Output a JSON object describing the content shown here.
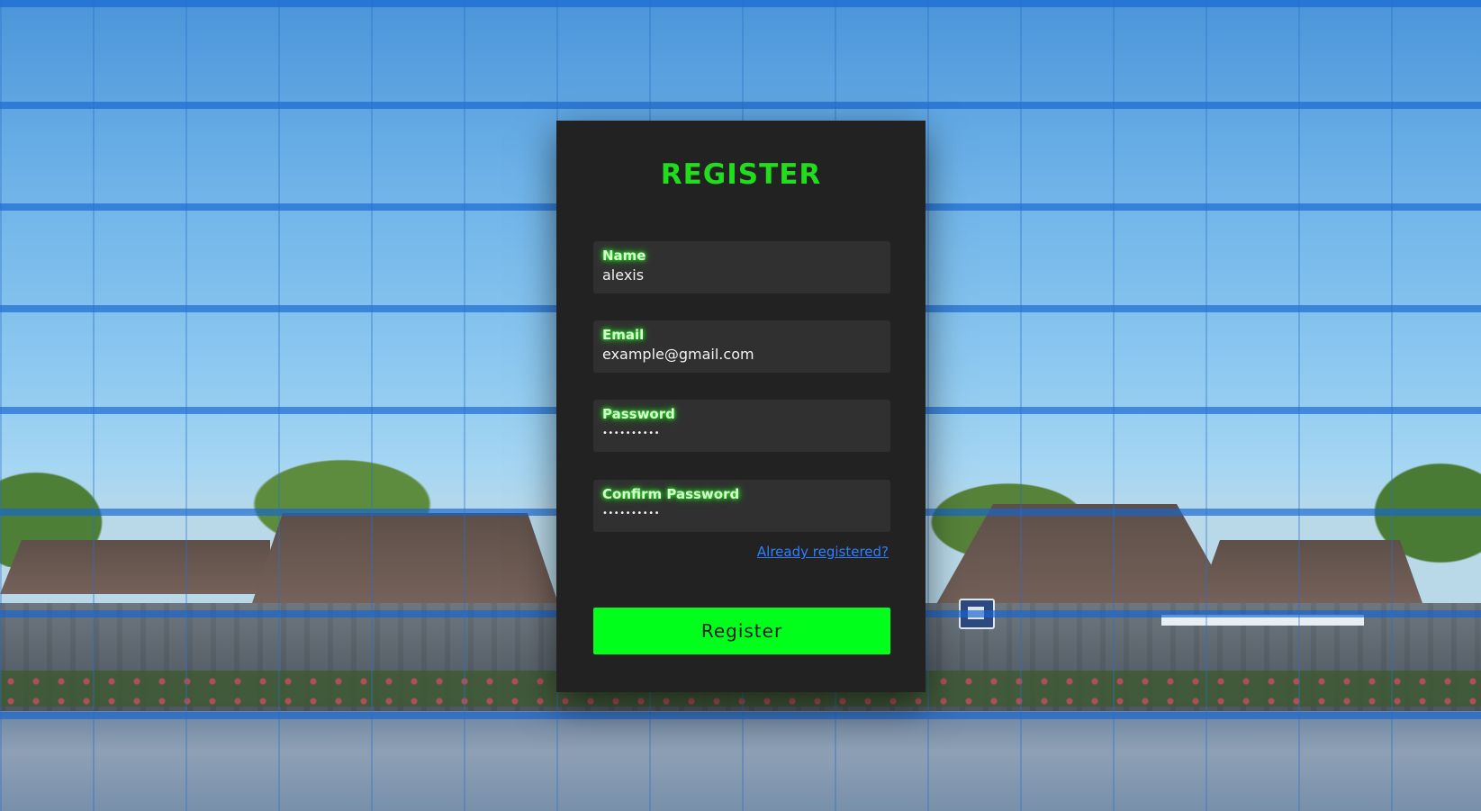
{
  "form": {
    "title": "REGISTER",
    "fields": [
      {
        "label": "Name",
        "value": "alexis",
        "type": "text"
      },
      {
        "label": "Email",
        "value": "example@gmail.com",
        "type": "email"
      },
      {
        "label": "Password",
        "value": "••••••••••",
        "type": "password"
      },
      {
        "label": "Confirm Password",
        "value": "••••••••••",
        "type": "password"
      }
    ],
    "login_link": "Already registered?",
    "submit_label": "Register"
  },
  "colors": {
    "accent_green": "#00ff1a",
    "title_green": "#21dd1e",
    "card_bg": "#222222",
    "field_bg": "#303030",
    "link_blue": "#2d7fff"
  }
}
